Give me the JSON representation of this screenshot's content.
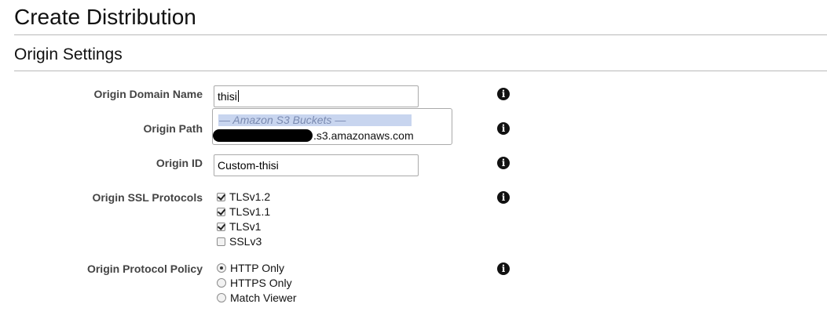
{
  "page": {
    "title": "Create Distribution",
    "section_title": "Origin Settings"
  },
  "origin_domain_name": {
    "label": "Origin Domain Name",
    "value": "thisi",
    "dropdown": {
      "group_label": "— Amazon S3 Buckets —",
      "option_suffix": ".s3.amazonaws.com"
    }
  },
  "origin_path": {
    "label": "Origin Path",
    "value": ""
  },
  "origin_id": {
    "label": "Origin ID",
    "value": "Custom-thisi"
  },
  "origin_ssl_protocols": {
    "label": "Origin SSL Protocols",
    "options": [
      {
        "label": "TLSv1.2",
        "checked": true
      },
      {
        "label": "TLSv1.1",
        "checked": true
      },
      {
        "label": "TLSv1",
        "checked": true
      },
      {
        "label": "SSLv3",
        "checked": false
      }
    ]
  },
  "origin_protocol_policy": {
    "label": "Origin Protocol Policy",
    "options": [
      {
        "label": "HTTP Only",
        "selected": true
      },
      {
        "label": "HTTPS Only",
        "selected": false
      },
      {
        "label": "Match Viewer",
        "selected": false
      }
    ]
  },
  "icons": {
    "info": "info-icon",
    "info_glyph": "i"
  }
}
